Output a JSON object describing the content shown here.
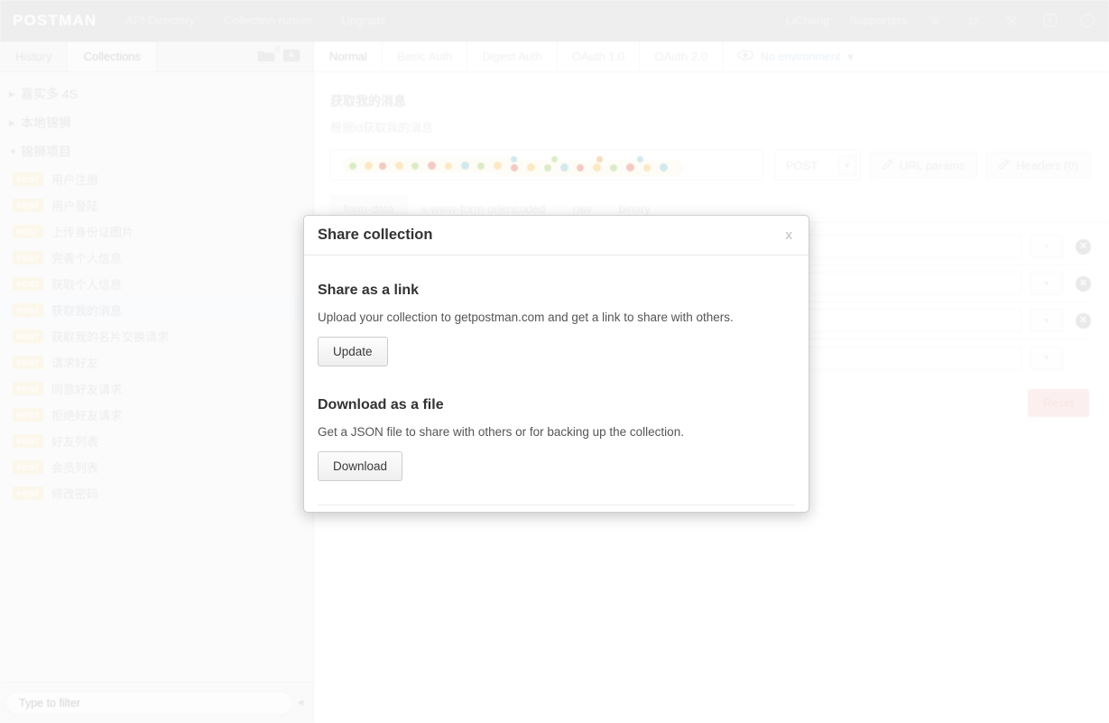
{
  "topbar": {
    "brand": "POSTMAN",
    "nav": [
      {
        "label": "API Directory"
      },
      {
        "label": "Collection runner"
      },
      {
        "label": "Upgrade"
      }
    ],
    "right_links": [
      {
        "label": "LiCheng"
      },
      {
        "label": "Supporters"
      }
    ],
    "icons": [
      {
        "name": "trophy-icon",
        "glyph": "♛"
      },
      {
        "name": "sync-icon",
        "glyph": "⇄"
      },
      {
        "name": "wrench-icon",
        "glyph": "⚒"
      },
      {
        "name": "save-icon",
        "glyph": "⤓"
      },
      {
        "name": "help-icon",
        "glyph": "?"
      }
    ]
  },
  "sidebar": {
    "tabs": [
      {
        "label": "History",
        "active": false
      },
      {
        "label": "Collections",
        "active": true
      }
    ],
    "tools": [
      {
        "name": "new-collection-icon",
        "badge": "0"
      },
      {
        "name": "import-collection-icon",
        "badge": ""
      }
    ],
    "groups": [
      {
        "label": "嘉实多 4S",
        "expanded": false,
        "caret": "▶"
      },
      {
        "label": "本地锦狮",
        "expanded": false,
        "caret": "▶"
      },
      {
        "label": "锦狮项目",
        "expanded": true,
        "caret": "▼"
      }
    ],
    "requests": [
      {
        "method": "POST",
        "label": "用户注册",
        "selected": false
      },
      {
        "method": "POST",
        "label": "用户登陆",
        "selected": false
      },
      {
        "method": "POST",
        "label": "上传身份证图片",
        "selected": false
      },
      {
        "method": "POST",
        "label": "完善个人信息",
        "selected": false
      },
      {
        "method": "POST",
        "label": "获取个人信息",
        "selected": false
      },
      {
        "method": "POST",
        "label": "获取我的消息",
        "selected": true
      },
      {
        "method": "POST",
        "label": "获取我的名片交换请求",
        "selected": false
      },
      {
        "method": "POST",
        "label": "请求好友",
        "selected": false
      },
      {
        "method": "POST",
        "label": "同意好友请求",
        "selected": false
      },
      {
        "method": "POST",
        "label": "拒绝好友请求",
        "selected": false
      },
      {
        "method": "POST",
        "label": "好友列表",
        "selected": false
      },
      {
        "method": "POST",
        "label": "会员列表",
        "selected": false
      },
      {
        "method": "POST",
        "label": "修改密码",
        "selected": false
      }
    ],
    "filter": {
      "placeholder": "Type to filter",
      "value": "",
      "collapse_glyph": "◀"
    }
  },
  "main": {
    "auth_tabs": [
      {
        "label": "Normal",
        "active": true
      },
      {
        "label": "Basic Auth",
        "active": false
      },
      {
        "label": "Digest Auth",
        "active": false
      },
      {
        "label": "OAuth 1.0",
        "active": false
      },
      {
        "label": "OAuth 2.0",
        "active": false
      }
    ],
    "environment": {
      "label": "No environment",
      "caret": "▾"
    },
    "request": {
      "title": "获取我的消息",
      "description": "根据id获取我的消息",
      "url_value": "",
      "method": "POST",
      "url_params_label": "URL params",
      "headers_label": "Headers (0)"
    },
    "body_tabs": [
      {
        "label": "form-data",
        "active": true
      },
      {
        "label": "x-www-form-urlencoded",
        "active": false
      },
      {
        "label": "raw",
        "active": false
      },
      {
        "label": "binary",
        "active": false
      }
    ],
    "kv_rows": [
      {
        "key": "",
        "value": "",
        "type": "",
        "deletable": true
      },
      {
        "key": "",
        "value": "",
        "type": "",
        "deletable": true
      },
      {
        "key": "",
        "value": "",
        "type": "",
        "deletable": true
      },
      {
        "key": "",
        "value": "",
        "type": "",
        "deletable": false
      }
    ],
    "reset_label": "Reset"
  },
  "modal": {
    "title": "Share collection",
    "close_label": "x",
    "sections": [
      {
        "heading": "Share as a link",
        "description": "Upload your collection to getpostman.com and get a link to share with others.",
        "button": "Update"
      },
      {
        "heading": "Download as a file",
        "description": "Get a JSON file to share with others or for backing up the collection.",
        "button": "Download"
      }
    ]
  },
  "colors": {
    "topbar_bg": "#c9c9c9",
    "method_badge": "#f5e6bf",
    "reset_bg": "#f6cdcd",
    "selected_row": "#eef3f7",
    "env_link": "#bcd3e8"
  }
}
